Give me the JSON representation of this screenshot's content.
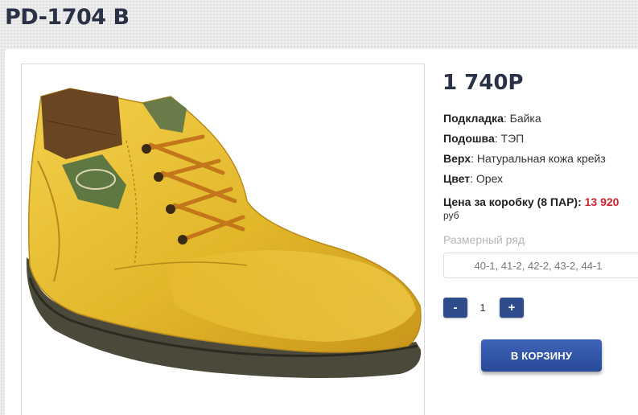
{
  "product": {
    "title": "PD-1704 B",
    "price": "1 740Р",
    "image_alt": "yellow leather ankle boot"
  },
  "specs": [
    {
      "label": "Подкладка",
      "value": ": Байка"
    },
    {
      "label": "Подошва",
      "value": ": ТЭП"
    },
    {
      "label": "Верх",
      "value": ": Натуральная кожа крейз"
    },
    {
      "label": "Цвет",
      "value": ": Орех"
    }
  ],
  "box_price": {
    "label": "Цена за коробку (8 ПАР):",
    "value": "13 920",
    "currency": "руб"
  },
  "sizes": {
    "label": "Размерный ряд",
    "selected": "40-1, 41-2, 42-2, 43-2, 44-1"
  },
  "quantity": {
    "minus": "-",
    "value": "1",
    "plus": "+"
  },
  "cart": {
    "label": "В КОРЗИНУ"
  },
  "colors": {
    "accent": "#2f4d8c",
    "price_red": "#d0202c",
    "title": "#2b3147"
  }
}
